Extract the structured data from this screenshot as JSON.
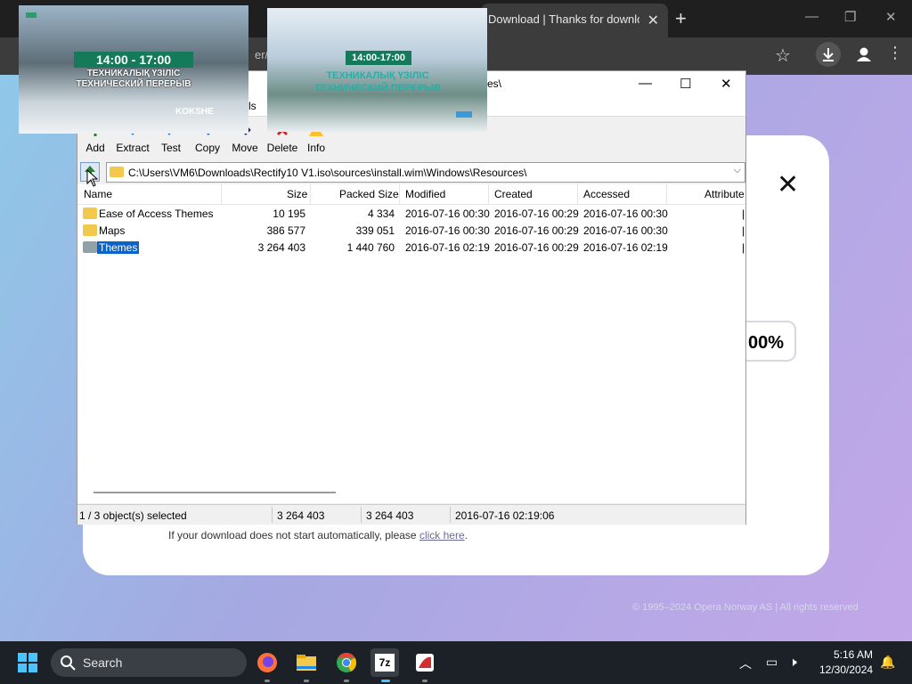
{
  "browser": {
    "tab_title": "Download | Thanks for downloa",
    "url_fragment": "er/t"
  },
  "page": {
    "percent": "00%",
    "note_text": "If your download does not start automatically, please ",
    "note_link": "click here",
    "note_end": ".",
    "copyright": "© 1995–2024 Opera Norway AS | All rights reserved"
  },
  "zip": {
    "title": "es\\",
    "menu_fragment": "ls",
    "toolbar": [
      "Add",
      "Extract",
      "Test",
      "Copy",
      "Move",
      "Delete",
      "Info"
    ],
    "path": "C:\\Users\\VM6\\Downloads\\Rectify10 V1.iso\\sources\\install.wim\\Windows\\Resources\\",
    "columns": [
      "Name",
      "Size",
      "Packed Size",
      "Modified",
      "Created",
      "Accessed",
      "Attribute"
    ],
    "rows": [
      {
        "name": "Ease of Access Themes",
        "size": "10 195",
        "packed": "4 334",
        "modified": "2016-07-16 00:30",
        "created": "2016-07-16 00:29",
        "accessed": "2016-07-16 00:30"
      },
      {
        "name": "Maps",
        "size": "386 577",
        "packed": "339 051",
        "modified": "2016-07-16 00:30",
        "created": "2016-07-16 00:29",
        "accessed": "2016-07-16 00:30"
      },
      {
        "name": "Themes",
        "size": "3 264 403",
        "packed": "1 440 760",
        "modified": "2016-07-16 02:19",
        "created": "2016-07-16 00:29",
        "accessed": "2016-07-16 02:19"
      }
    ],
    "status": {
      "selected": "1 / 3 object(s) selected",
      "size": "3 264 403",
      "packed": "3 264 403",
      "modified": "2016-07-16 02:19:06"
    }
  },
  "thumbs": {
    "t1_time": "14:00 - 17:00",
    "t1_line1": "ТЕХНИКАЛЫҚ ҮЗІЛІС",
    "t1_line2": "ТЕХНИЧЕСКИЙ ПЕРЕРЫВ",
    "t1_logo": "KOKSHE",
    "t2_time": "14:00-17:00",
    "t2_line1": "ТЕХНИКАЛЫҚ ҮЗІЛІС",
    "t2_line2": "ТЕХНИЧЕСКИЙ ПЕРЕРЫВ"
  },
  "taskbar": {
    "search_label": "Search",
    "time": "5:16 AM",
    "date": "12/30/2024"
  },
  "colors": {
    "selection": "#0a63c9",
    "folder": "#f2c94c",
    "taskbar": "#1c2127"
  }
}
